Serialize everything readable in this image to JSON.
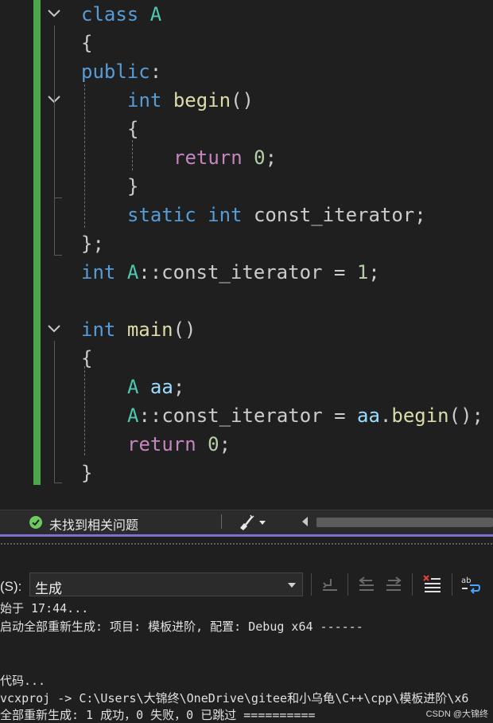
{
  "editor": {
    "lines": [
      {
        "text": "class A"
      },
      {
        "text": "{"
      },
      {
        "text": "public:"
      },
      {
        "text": "int begin()"
      },
      {
        "text": "{"
      },
      {
        "text": "return 0;"
      },
      {
        "text": "}"
      },
      {
        "text": "static int const_iterator;"
      },
      {
        "text": "};"
      },
      {
        "text": "int A::const_iterator = 1;"
      },
      {
        "text": ""
      },
      {
        "text": "int main()"
      },
      {
        "text": "{"
      },
      {
        "text": "A aa;"
      },
      {
        "text": "A::const_iterator = aa.begin();"
      },
      {
        "text": "return 0;"
      },
      {
        "text": "}"
      }
    ],
    "tokens": {
      "class_kw": "class",
      "class_name": "A",
      "open_brace": "{",
      "close_brace": "}",
      "close_class": "};",
      "public_kw": "public",
      "colon": ":",
      "int_kw": "int",
      "begin_fn": "begin",
      "parens": "()",
      "return_kw": "return",
      "zero": "0",
      "semicolon": ";",
      "static_kw": "static",
      "const_iterator": "const_iterator",
      "scope": "::",
      "assign": " = ",
      "one": "1",
      "main_fn": "main",
      "aa_var": "aa",
      "dot": "."
    },
    "colors": {
      "keyword": "#569cd6",
      "type": "#4ec9b0",
      "function": "#dcdcaa",
      "control": "#c586c0",
      "number": "#b5cea8",
      "variable": "#9cdcfe",
      "changed_bar": "#4ca64c"
    }
  },
  "status_strip": {
    "issues_icon": "check-circle-icon",
    "issues_text": "未找到相关问题",
    "cleanup_icon": "brush-icon"
  },
  "output": {
    "source_label": "(S):",
    "source_value": "生成",
    "toolbar_icons": [
      "go-to-previous-icon",
      "find-previous-icon",
      "find-next-icon",
      "clear-all-icon",
      "word-wrap-icon"
    ],
    "lines": [
      "始于 17:44...",
      "启动全部重新生成: 项目: 模板进阶, 配置: Debug x64 ------",
      "",
      "",
      "代码...",
      "vcxproj -> C:\\Users\\大锦终\\OneDrive\\gitee和小乌龟\\C++\\cpp\\模板进阶\\x6",
      "全部重新生成: 1 成功，0 失败，0 已跳过 =========="
    ],
    "accent_color": "#7d6ecf"
  },
  "watermark": "CSDN @大锦终"
}
